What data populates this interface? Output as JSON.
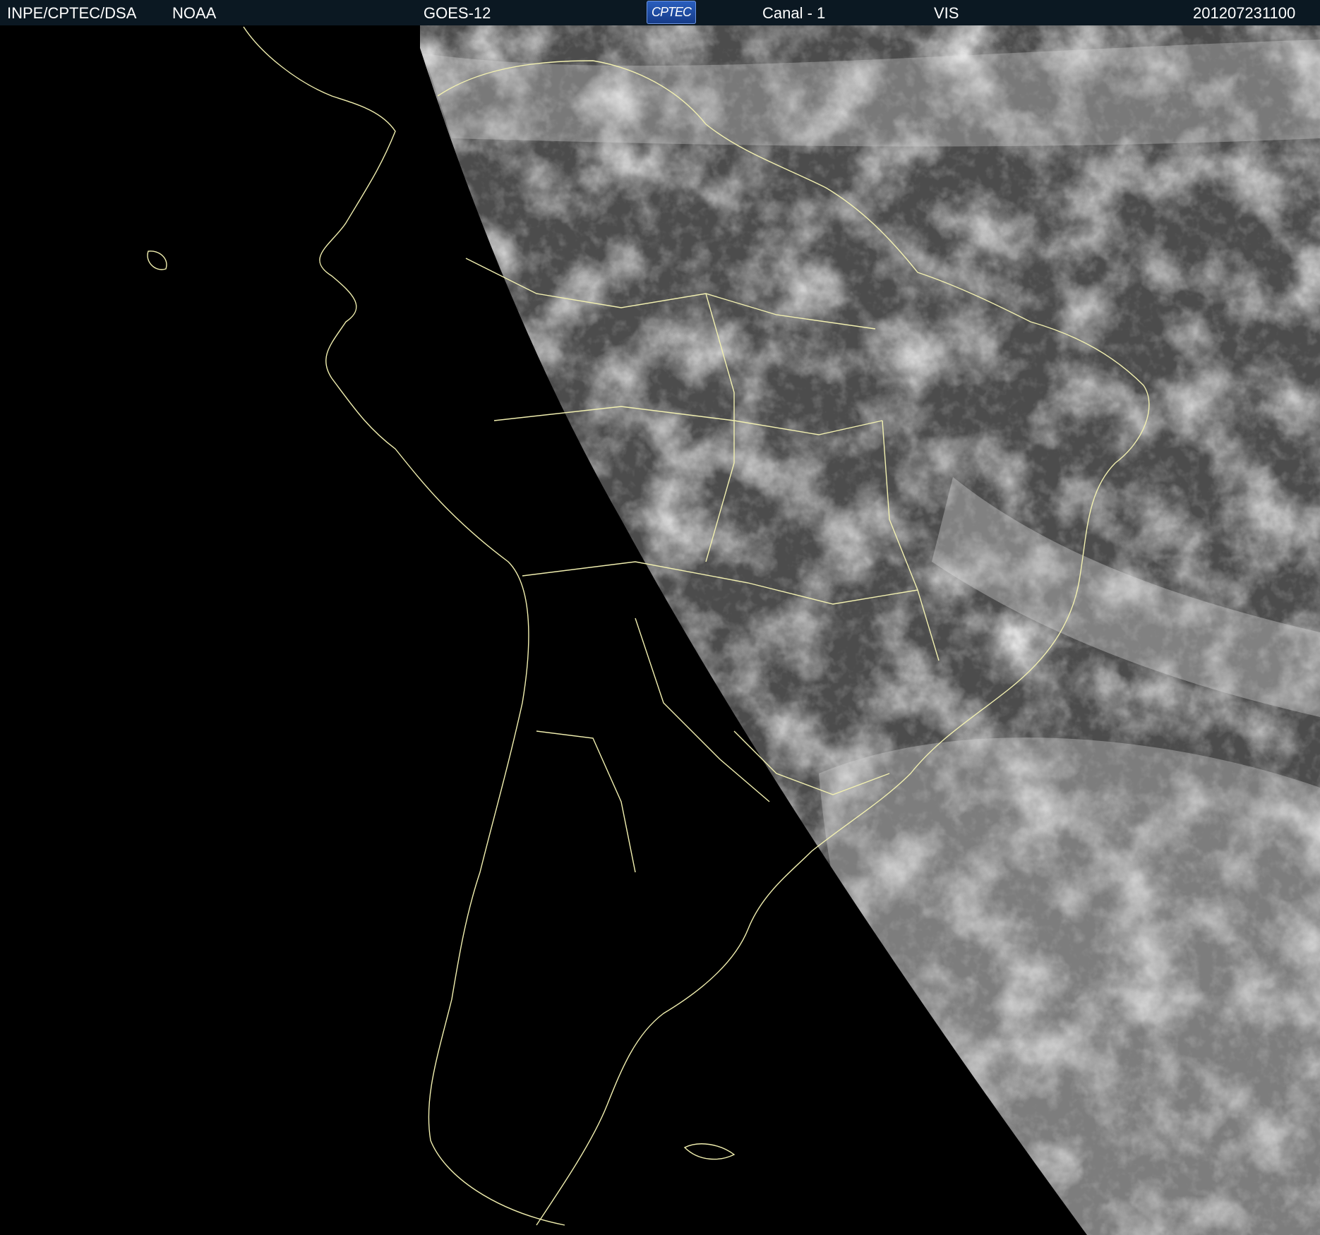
{
  "header": {
    "source": "INPE/CPTEC/DSA",
    "agency": "NOAA",
    "satellite": "GOES-12",
    "logo_text": "CPTEC",
    "channel": "Canal - 1",
    "band": "VIS",
    "timestamp": "201207231100"
  },
  "map": {
    "image_type": "satellite visible imagery",
    "region": "South America",
    "coastline_color": "#f2f0b0",
    "night_side_color": "#000000",
    "cloud_color": "#eeeeee"
  }
}
